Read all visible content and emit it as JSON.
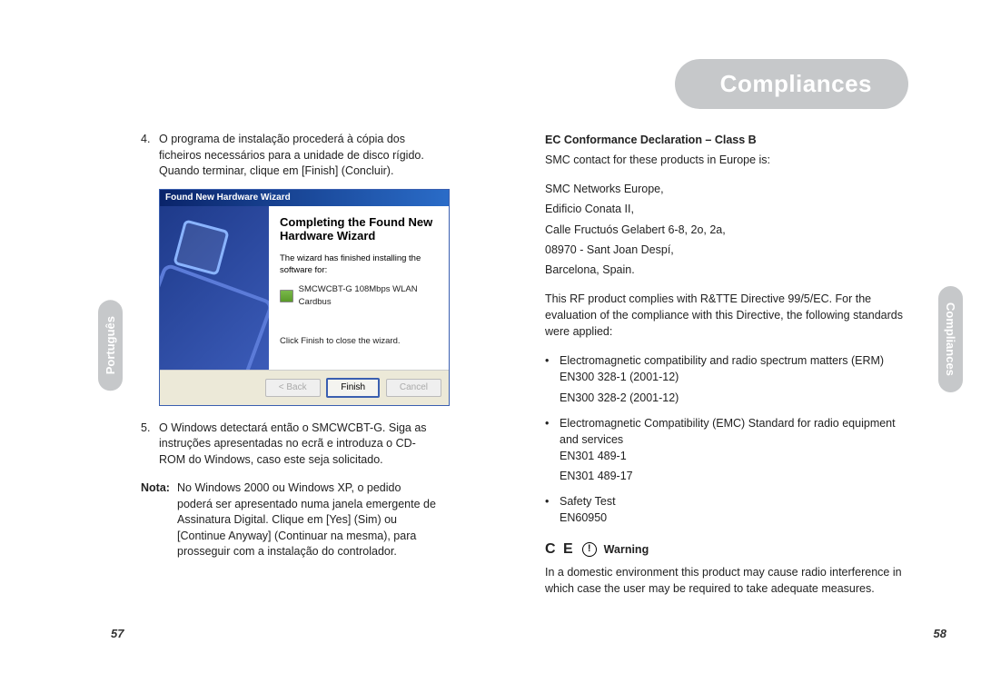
{
  "leftTab": "Português",
  "rightTab": "Compliances",
  "headerPill": "Compliances",
  "leftPage": {
    "item4": "O programa de instalação procederá à cópia dos ficheiros necessários para a unidade de disco rígido. Quando terminar, clique em [Finish] (Concluir).",
    "wizard": {
      "title": "Found New Hardware Wizard",
      "heading": "Completing the Found New Hardware Wizard",
      "text1": "The wizard has finished installing the software for:",
      "device": "SMCWCBT-G 108Mbps WLAN Cardbus",
      "text2": "Click Finish to close the wizard.",
      "back": "< Back",
      "finish": "Finish",
      "cancel": "Cancel"
    },
    "item5": "O Windows detectará então o SMCWCBT-G. Siga as instruções apresentadas no ecrã e introduza o CD-ROM do Windows, caso este seja solicitado.",
    "notaLabel": "Nota:",
    "notaText": "No Windows 2000 ou Windows XP, o pedido poderá ser apresentado numa janela emergente de Assinatura Digital. Clique em [Yes] (Sim) ou [Continue Anyway] (Continuar na mesma), para prosseguir com a instalação do controlador.",
    "pageNum": "57"
  },
  "rightPage": {
    "h1": "EC Conformance Declaration – Class B",
    "contactIntro": "SMC contact for these products in Europe is:",
    "addr1": "SMC Networks Europe,",
    "addr2": "Edificio Conata II,",
    "addr3": "Calle Fructuós Gelabert 6-8, 2o, 2a,",
    "addr4": "08970 - Sant Joan Despí,",
    "addr5": "Barcelona, Spain.",
    "rfText": "This RF product complies with R&TTE Directive 99/5/EC. For the evaluation of the compliance with this Directive, the following standards were applied:",
    "b1": "Electromagnetic compatibility and radio spectrum matters (ERM)",
    "b1a": "EN300 328-1 (2001-12)",
    "b1b": "EN300 328-2 (2001-12)",
    "b2": "Electromagnetic Compatibility (EMC) Standard for radio equipment and services",
    "b2a": "EN301 489-1",
    "b2b": "EN301 489-17",
    "b3": "Safety Test",
    "b3a": "EN60950",
    "warnLabel": "Warning",
    "warnText": "In a domestic environment this product may cause radio interference in which case the user may be required to take adequate measures.",
    "pageNum": "58"
  }
}
